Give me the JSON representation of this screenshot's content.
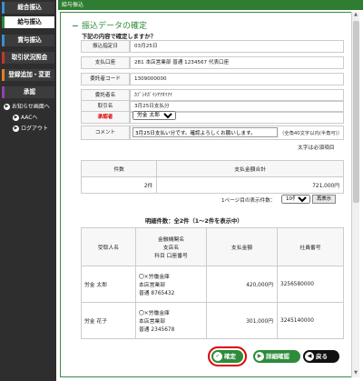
{
  "sidebar": {
    "items": [
      {
        "label": "総合振込"
      },
      {
        "label": "給与振込"
      },
      {
        "label": "賞与振込"
      },
      {
        "label": "取引状況照会"
      },
      {
        "label": "登録追加・変更"
      },
      {
        "label": "承認"
      }
    ],
    "subitems": [
      {
        "label": "お知らせ画面へ"
      },
      {
        "label": "AACへ"
      },
      {
        "label": "ログアウト"
      }
    ]
  },
  "topbar": {
    "title": "給与振込"
  },
  "page": {
    "title": "振込データの確定",
    "question": "下記の内容で確定しますか？",
    "required_note": "太字は必須項目"
  },
  "form": {
    "fields": [
      {
        "label": "振込指定日",
        "value": "03月25日"
      },
      {
        "label": "支払口座",
        "value": "281 本店営業部 普通 1234567 代表口座"
      },
      {
        "label": "委託者コード",
        "value": "1309000000"
      },
      {
        "label": "委託者名",
        "value": "ｶﾌﾞｼｷｶﾞｲｼﾔｱｵｲｱｲ"
      },
      {
        "label": "取引名",
        "value": "3月25日支払分"
      },
      {
        "label": "承認者",
        "value": ""
      },
      {
        "label": "コメント",
        "value": ""
      }
    ],
    "approver_selected": "労金 太郎",
    "comment_value": "3月25日支払い分です。確認よろしくお願いします。",
    "comment_note": "（全角40文字以内(半角可)）"
  },
  "summary": {
    "headers": [
      "件数",
      "支払金額合計"
    ],
    "values": [
      "2件",
      "721,000円"
    ]
  },
  "pager": {
    "label": "1ページ目の表示件数：",
    "selected": "10件",
    "redisplay": "再表示"
  },
  "detail": {
    "header": "明細件数：全2件（1～2件を表示中）",
    "columns": [
      "受取人名",
      "金融機関名\n支店名\n科目 口座番号",
      "支払金額",
      "社員番号"
    ],
    "rows": [
      {
        "name": "労金 太郎",
        "bank": "〇×労働金庫",
        "branch": "本店営業部",
        "account": "普通 8765432",
        "amount": "420,000円",
        "employee": "3256580000"
      },
      {
        "name": "労金 花子",
        "bank": "〇×労働金庫",
        "branch": "本店営業部",
        "account": "普通 2345678",
        "amount": "301,000円",
        "employee": "3245140000"
      }
    ]
  },
  "buttons": {
    "confirm": "確定",
    "detail": "詳細確認",
    "back": "戻る"
  },
  "colors": {
    "accent_green": "#2e8b3a",
    "sidebar": "#2e2e2e",
    "required_red": "#dd0000"
  }
}
